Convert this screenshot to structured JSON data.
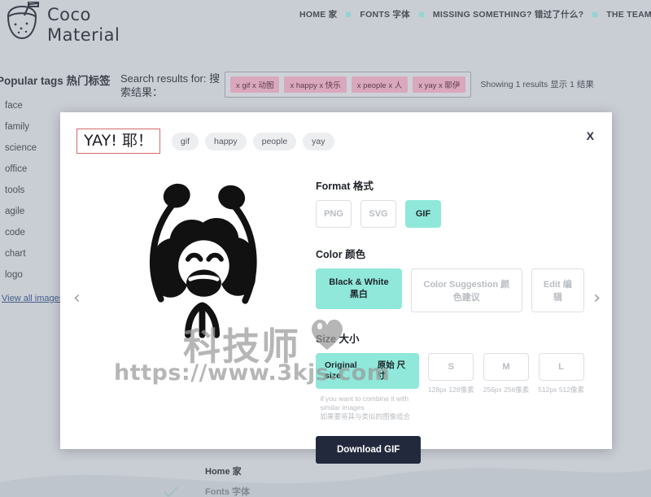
{
  "header": {
    "logo_text_line1": "Coco",
    "logo_text_line2": "Material",
    "logo_icon": "coconut-drink-icon",
    "nav": [
      {
        "label": "HOME 家",
        "name": "nav-home"
      },
      {
        "label": "FONTS 字体",
        "name": "nav-fonts"
      },
      {
        "label": "MISSING SOMETHING? 错过了什么?",
        "name": "nav-missing"
      },
      {
        "label": "THE TEAM 团队",
        "name": "nav-team"
      }
    ]
  },
  "sidebar": {
    "title": "Popular tags 热门标签",
    "tags": [
      "face",
      "family",
      "science",
      "office",
      "tools",
      "agile",
      "code",
      "chart",
      "logo"
    ],
    "view_all": "View all images"
  },
  "search": {
    "label": "Search results for: 搜索结果：",
    "chips": [
      "x gif x 动图",
      "x happy x 快乐",
      "x people x 人",
      "x yay x 耶伊"
    ],
    "showing": "Showing 1 results 显示 1 结果"
  },
  "modal": {
    "title": "YAY! 耶！",
    "tags": [
      "gif",
      "happy",
      "people",
      "yay"
    ],
    "close_label": "X",
    "prev_label": "‹",
    "next_label": "›",
    "preview_alt": "cheering-person-illustration",
    "format": {
      "label": "Format 格式",
      "options": [
        {
          "label": "PNG",
          "selected": false,
          "disabled": true
        },
        {
          "label": "SVG",
          "selected": false,
          "disabled": true
        },
        {
          "label": "GIF",
          "selected": true,
          "disabled": false
        }
      ]
    },
    "color": {
      "label": "Color 颜色",
      "options": [
        {
          "label": "Black & White 黑白",
          "selected": true,
          "disabled": false
        },
        {
          "label": "Color Suggestion 颜色建议",
          "selected": false,
          "disabled": true
        },
        {
          "label": "Edit 编辑",
          "selected": false,
          "disabled": true
        }
      ]
    },
    "size": {
      "label": "Size 大小",
      "original_en": "Original size",
      "original_cn": "原始 尺寸",
      "options": [
        {
          "label": "S",
          "caption": "128px 128像素",
          "selected": false,
          "disabled": true
        },
        {
          "label": "M",
          "caption": "256px 256像素",
          "selected": false,
          "disabled": true
        },
        {
          "label": "L",
          "caption": "512px 512像素",
          "selected": false,
          "disabled": true
        }
      ],
      "helper_en": "if you want to combine it with similar images",
      "helper_cn": "如果要将其与类似的图像组合"
    },
    "download_label": "Download GIF"
  },
  "footer": {
    "links": [
      "Home 家",
      "Fonts 字体"
    ]
  },
  "watermark": {
    "text_cn": "科技师",
    "url": "https://www.3kjs.com",
    "heart": "heart-icon"
  },
  "colors": {
    "page_bg": "#c9cdd4",
    "accent_teal": "#8fe8da",
    "chip_pink": "#d9a8bd",
    "download_navy": "#23293d",
    "title_border_red": "#d56a6a"
  }
}
